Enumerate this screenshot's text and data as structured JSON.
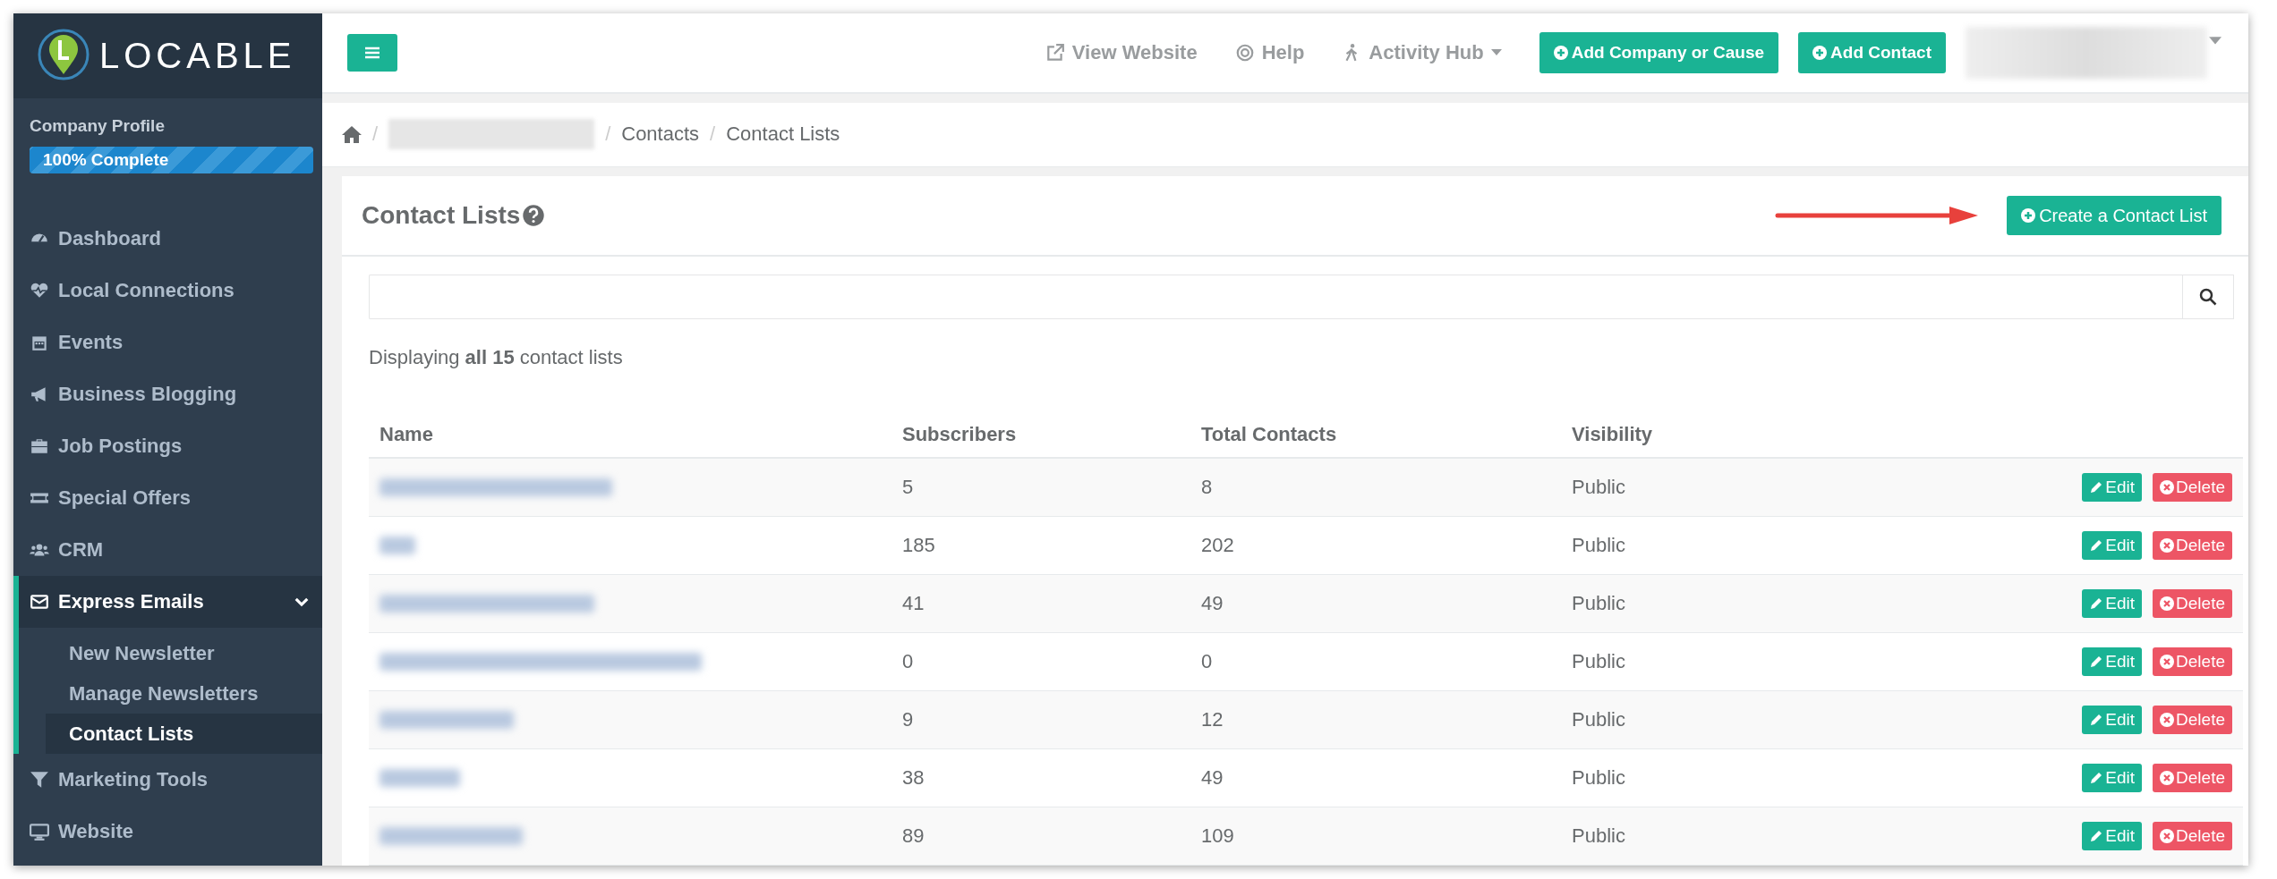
{
  "logo": {
    "text": "LOCABLE"
  },
  "profile": {
    "label": "Company Profile",
    "progress": "100% Complete",
    "level": 1
  },
  "sidebar": {
    "items": [
      {
        "label": "Dashboard",
        "selected": false
      },
      {
        "label": "Local Connections",
        "selected": false
      },
      {
        "label": "Events",
        "selected": false
      },
      {
        "label": "Business Blogging",
        "selected": false
      },
      {
        "label": "Job Postings",
        "selected": false
      },
      {
        "label": "Special Offers",
        "selected": false
      },
      {
        "label": "CRM",
        "selected": false
      },
      {
        "label": "Express Emails",
        "expanded": true,
        "children": [
          {
            "label": "New Newsletter",
            "selected": false
          },
          {
            "label": "Manage Newsletters",
            "selected": false
          },
          {
            "label": "Contact Lists",
            "selected": true
          }
        ]
      },
      {
        "label": "Marketing Tools",
        "selected": false
      },
      {
        "label": "Website",
        "selected": false
      }
    ]
  },
  "topbar": {
    "links": [
      {
        "label": "View Website"
      },
      {
        "label": "Help"
      },
      {
        "label": "Activity Hub"
      }
    ],
    "buttons": [
      "Add Company or Cause",
      "Add Contact"
    ]
  },
  "breadcrumb": {
    "separator": "/",
    "items": [
      "Contacts",
      "Contact Lists"
    ]
  },
  "card": {
    "title": "Contact Lists",
    "create_button": "Create a Contact List",
    "summary": "Displaying **all 15** contact lists",
    "table": {
      "columns": [
        "Name",
        "Subscribers",
        "Total Contacts",
        "Visibility"
      ],
      "rows": [
        {
          "subscribers": "5",
          "total": "8",
          "visibility": "Public",
          "edit": "Edit",
          "delete": "Delete"
        },
        {
          "subscribers": "185",
          "total": "202",
          "visibility": "Public",
          "edit": "Edit",
          "delete": "Delete"
        },
        {
          "subscribers": "41",
          "total": "49",
          "visibility": "Public",
          "edit": "Edit",
          "delete": "Delete"
        },
        {
          "subscribers": "0",
          "total": "0",
          "visibility": "Public",
          "edit": "Edit",
          "delete": "Delete"
        },
        {
          "subscribers": "9",
          "total": "12",
          "visibility": "Public",
          "edit": "Edit",
          "delete": "Delete"
        },
        {
          "subscribers": "38",
          "total": "49",
          "visibility": "Public",
          "edit": "Edit",
          "delete": "Delete"
        },
        {
          "subscribers": "89",
          "total": "109",
          "visibility": "Public",
          "edit": "Edit",
          "delete": "Delete"
        }
      ]
    }
  }
}
